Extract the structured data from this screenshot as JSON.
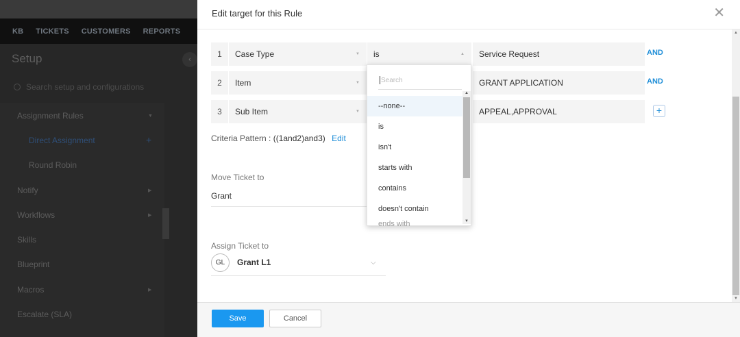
{
  "background": {
    "nav": [
      "KB",
      "TICKETS",
      "CUSTOMERS",
      "REPORTS"
    ],
    "title": "Setup",
    "search_placeholder": "Search setup and configurations",
    "items": [
      {
        "label": "Assignment Rules"
      },
      {
        "label": "Direct Assignment"
      },
      {
        "label": "Round Robin"
      },
      {
        "label": "Notify"
      },
      {
        "label": "Workflows"
      },
      {
        "label": "Skills"
      },
      {
        "label": "Blueprint"
      },
      {
        "label": "Macros"
      },
      {
        "label": "Escalate (SLA)"
      }
    ]
  },
  "modal": {
    "title": "Edit target for this Rule",
    "close_icon": "close-icon",
    "criteria": [
      {
        "num": "1",
        "field": "Case Type",
        "operator": "is",
        "value": "Service Request",
        "connector": "AND"
      },
      {
        "num": "2",
        "field": "Item",
        "operator": "",
        "value": "GRANT APPLICATION",
        "connector": "AND"
      },
      {
        "num": "3",
        "field": "Sub Item",
        "operator": "",
        "value": "APPEAL,APPROVAL",
        "connector": "+"
      }
    ],
    "criteria_pattern_label": "Criteria Pattern :",
    "criteria_pattern": "((1and2)and3)",
    "criteria_edit": "Edit",
    "move_label": "Move Ticket to",
    "move_value": "Grant",
    "assign_label": "Assign Ticket to",
    "assignee_initials": "GL",
    "assignee_name": "Grant L1"
  },
  "dropdown": {
    "search_placeholder": "Search",
    "options": [
      "--none--",
      "is",
      "isn't",
      "starts with",
      "contains",
      "doesn't contain",
      "ends with"
    ],
    "highlighted": "--none--"
  },
  "footer": {
    "save": "Save",
    "cancel": "Cancel"
  },
  "colors": {
    "accent": "#1a98f0",
    "link": "#1f8ed8"
  }
}
